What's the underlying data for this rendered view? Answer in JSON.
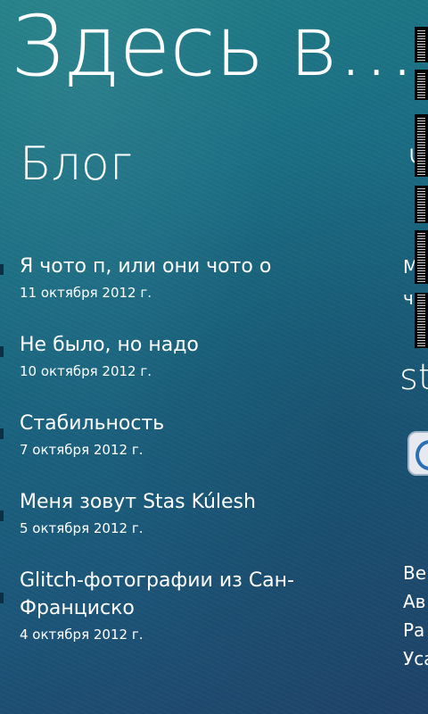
{
  "app": {
    "panorama_title": "Здесь в..."
  },
  "blog": {
    "header": "Блог",
    "posts": [
      {
        "title": "Я чото п, или они чото о",
        "date": "11 октября 2012 г."
      },
      {
        "title": "Не было, но надо",
        "date": "10 октября 2012 г."
      },
      {
        "title": "Стабильность",
        "date": "7 октября 2012 г."
      },
      {
        "title": "Меня зовут Stas Kúlesh",
        "date": "5 октября 2012 г."
      },
      {
        "title": "Glitch-фотографии из Сан-Франциско",
        "date": "4 октября 2012 г."
      }
    ]
  },
  "peek": {
    "header": "Ч",
    "line1": "Мо",
    "line2": "чи",
    "brand": "st",
    "button_icon": "opera-icon",
    "menu": [
      "Ве",
      "Ав",
      "Ра",
      "Уса"
    ]
  },
  "colors": {
    "background_top": "#1f7f86",
    "background_bottom": "#1f4269",
    "text": "#ffffff"
  }
}
